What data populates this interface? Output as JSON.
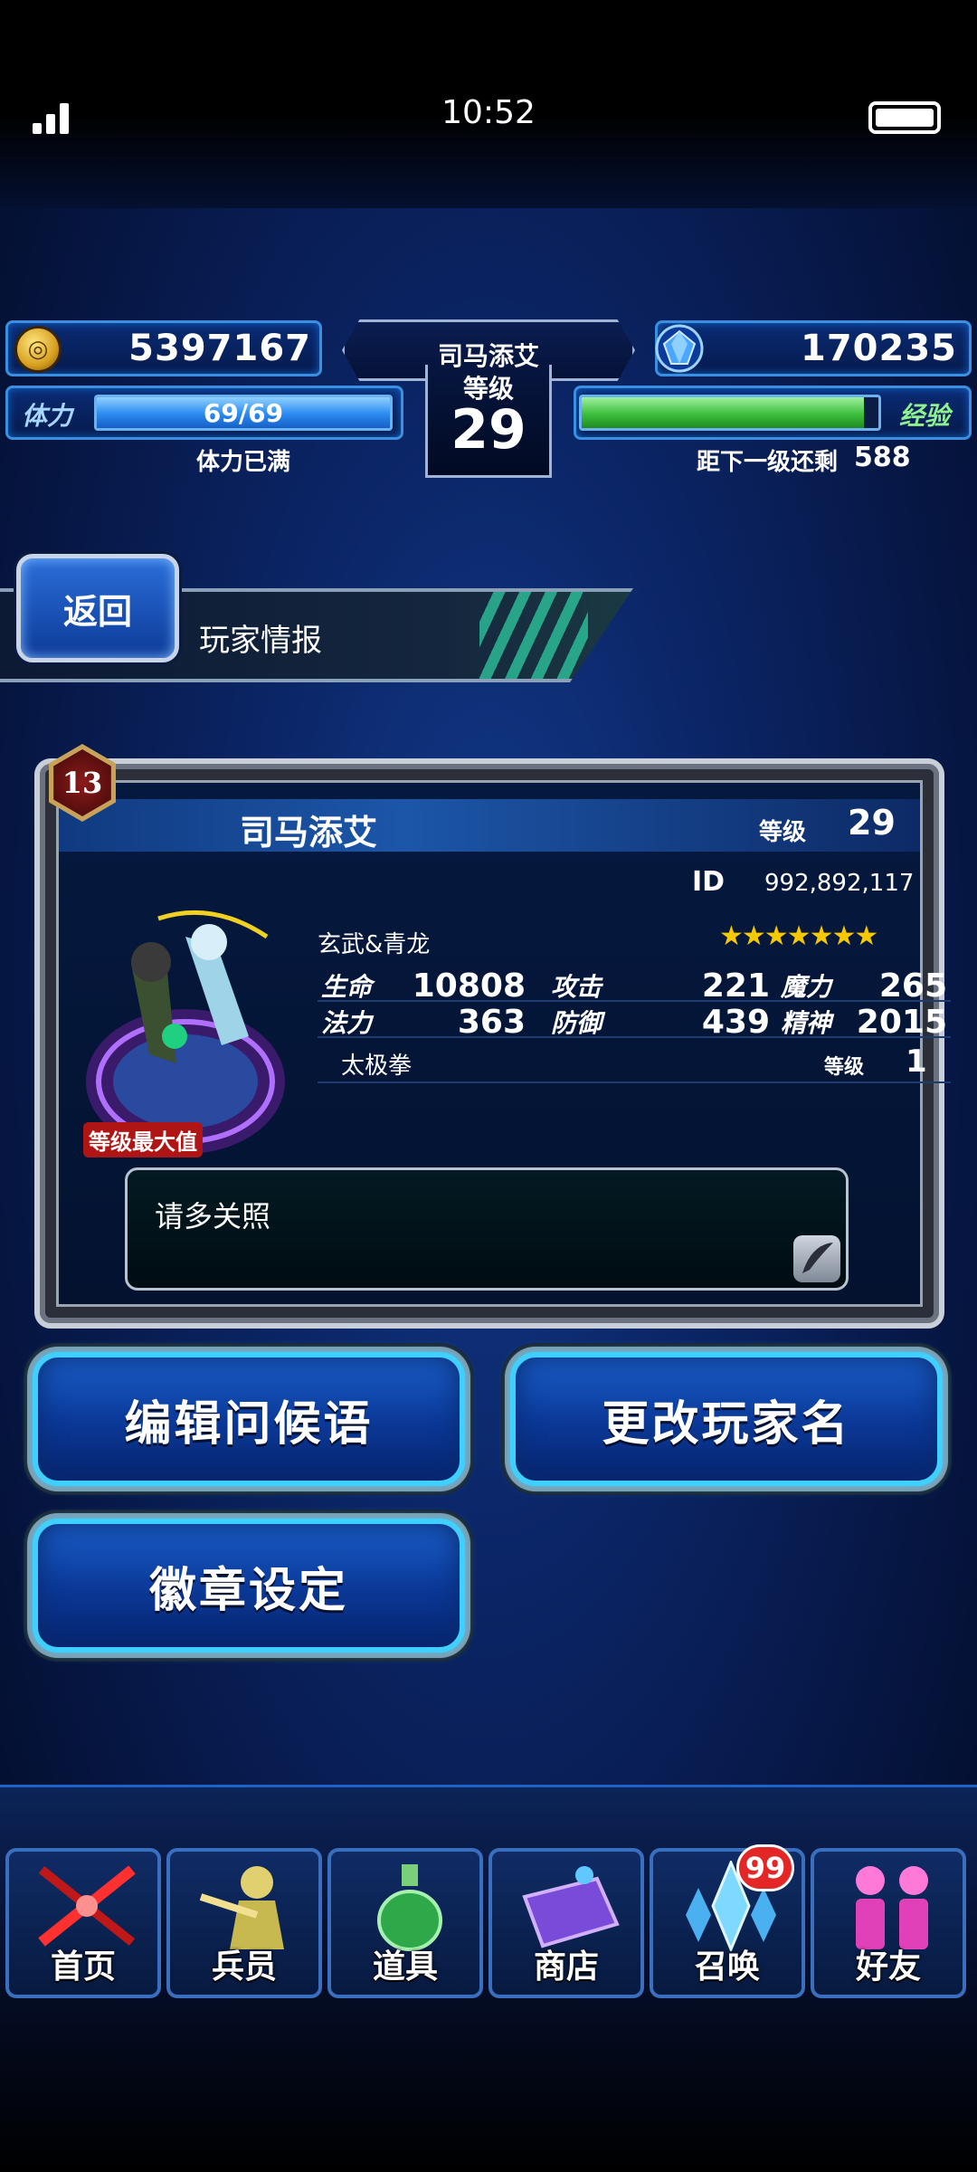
{
  "status_bar": {
    "time": "10:52"
  },
  "hud": {
    "gil": "5397167",
    "gems": "170235",
    "player_name": "司马添艾",
    "level_label": "等级",
    "level": "29",
    "stamina_label": "体力",
    "stamina": "69/69",
    "stamina_fill": 1.0,
    "stamina_status": "体力已满",
    "exp_label": "经验",
    "exp_fill": 0.95,
    "exp_remaining_label": "距下一级还剩",
    "exp_remaining": "588"
  },
  "header": {
    "back_label": "返回",
    "title": "玩家情报"
  },
  "profile": {
    "rank_badge": "13",
    "name": "司马添艾",
    "level_label": "等级",
    "level": "29",
    "id_label": "ID",
    "id_value": "992,892,117",
    "unit_name": "玄武&青龙",
    "stars": "★★★★★★★",
    "max_level_tag": "等级最大值",
    "stats": {
      "hp_label": "生命",
      "hp": "10808",
      "atk_label": "攻击",
      "atk": "221",
      "mag_label": "魔力",
      "mag": "265",
      "mp_label": "法力",
      "mp": "363",
      "def_label": "防御",
      "def": "439",
      "spr_label": "精神",
      "spr": "2015"
    },
    "ability_name": "太极拳",
    "ability_level_label": "等级",
    "ability_level": "1",
    "greeting": "请多关照"
  },
  "buttons": {
    "edit_greeting": "编辑问候语",
    "change_name": "更改玩家名",
    "badge_settings": "徽章设定"
  },
  "nav": {
    "items": [
      {
        "label": "首页",
        "icon": "sword-icon"
      },
      {
        "label": "兵员",
        "icon": "unit-icon"
      },
      {
        "label": "道具",
        "icon": "potion-icon"
      },
      {
        "label": "商店",
        "icon": "shop-icon"
      },
      {
        "label": "召唤",
        "icon": "crystal-icon"
      },
      {
        "label": "好友",
        "icon": "friends-icon"
      }
    ],
    "summon_badge": "99"
  },
  "colors": {
    "stamina_bar": "#39a6ff",
    "exp_bar": "#4ec84e",
    "button_glow": "#3fd0ff",
    "badge_red": "#e32626"
  }
}
